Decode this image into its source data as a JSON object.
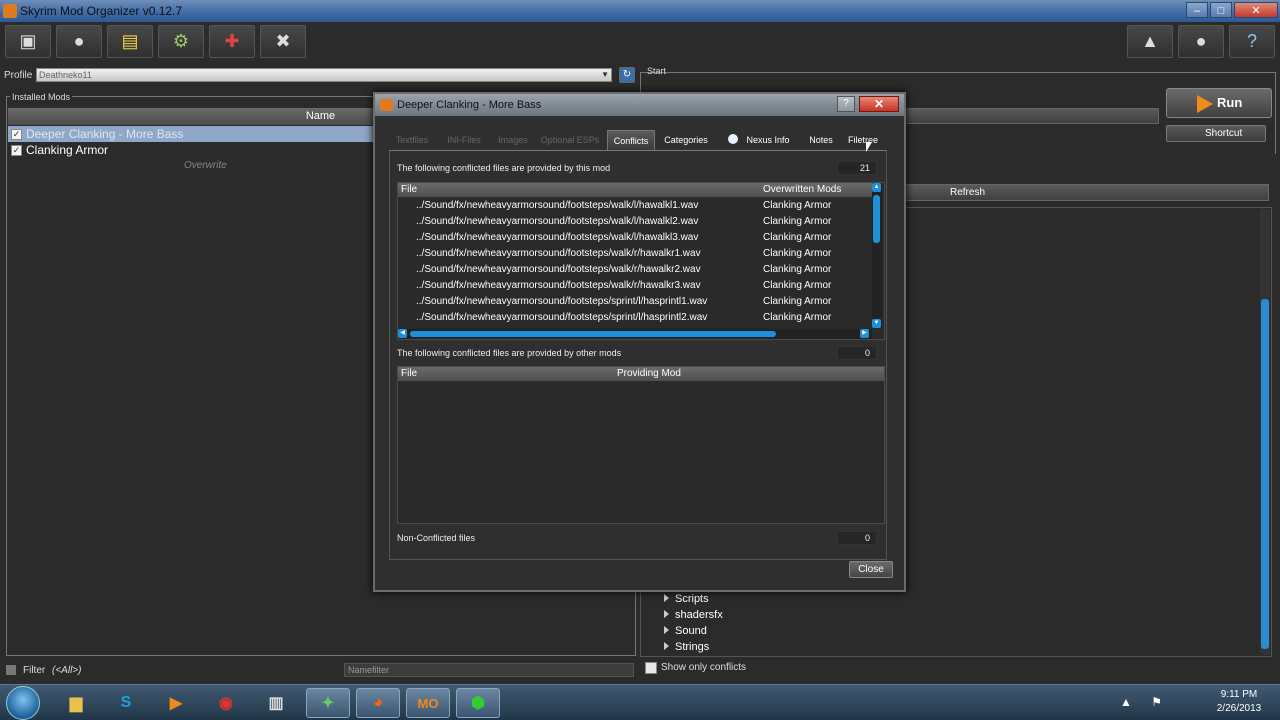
{
  "window": {
    "title": "Skyrim Mod Organizer v0.12.7",
    "controls": {
      "minimize": "–",
      "maximize": "□",
      "close": "✕"
    }
  },
  "toolbar": {
    "buttons": [
      {
        "name": "install-mod-button",
        "icon": "install-archive-icon",
        "glyph": "▣"
      },
      {
        "name": "nexus-button",
        "icon": "globe-icon",
        "glyph": "●"
      },
      {
        "name": "profiles-button",
        "icon": "profile-card-icon",
        "glyph": "▤"
      },
      {
        "name": "executables-button",
        "icon": "gears-icon",
        "glyph": "⚙"
      },
      {
        "name": "tools-dropdown-button",
        "icon": "puzzle-icon",
        "glyph": "✚"
      },
      {
        "name": "settings-button",
        "icon": "wrench-icon",
        "glyph": "✖"
      }
    ],
    "right_buttons": [
      {
        "name": "problems-button",
        "icon": "warning-icon",
        "glyph": "▲"
      },
      {
        "name": "update-button",
        "icon": "globe-update-icon",
        "glyph": "●"
      },
      {
        "name": "help-button",
        "icon": "help-icon",
        "glyph": "?"
      }
    ]
  },
  "profile": {
    "label": "Profile",
    "value": "Deathneko11"
  },
  "installed_mods": {
    "group_label": "Installed Mods",
    "column_name": "Name",
    "rows": [
      {
        "label": "Deeper Clanking - More Bass",
        "checked": true,
        "selected": true
      },
      {
        "label": "Clanking Armor",
        "checked": true,
        "selected": false
      }
    ],
    "overwrite": "Overwrite"
  },
  "filter": {
    "label": "Filter",
    "value": "(<All>)",
    "namefilter_placeholder": "Namefilter"
  },
  "right_panel": {
    "start_label": "Start",
    "run_label": "Run",
    "shortcut_label": "Shortcut",
    "refresh_label": "Refresh",
    "tree_items": [
      "Scripts",
      "shadersfx",
      "Sound",
      "Strings"
    ],
    "show_only_conflicts": "Show only conflicts"
  },
  "dialog": {
    "title": "Deeper Clanking - More Bass",
    "help_glyph": "?",
    "close_glyph": "✕",
    "tabs": [
      {
        "label": "Textfiles",
        "state": "disabled"
      },
      {
        "label": "INI-Files",
        "state": "disabled"
      },
      {
        "label": "Images",
        "state": "disabled"
      },
      {
        "label": "Optional ESPs",
        "state": "disabled"
      },
      {
        "label": "Conflicts",
        "state": "active"
      },
      {
        "label": "Categories",
        "state": "enabled"
      },
      {
        "label": "Nexus Info",
        "state": "enabled"
      },
      {
        "label": "Notes",
        "state": "enabled"
      },
      {
        "label": "Filetree",
        "state": "enabled"
      }
    ],
    "section1_label": "The following conflicted files are provided by this mod",
    "section1_count": "21",
    "table1": {
      "col_file": "File",
      "col_mods": "Overwritten Mods",
      "rows": [
        {
          "file": "../Sound/fx/newheavyarmorsound/footsteps/walk/l/hawalkl1.wav",
          "mod": "Clanking Armor"
        },
        {
          "file": "../Sound/fx/newheavyarmorsound/footsteps/walk/l/hawalkl2.wav",
          "mod": "Clanking Armor"
        },
        {
          "file": "../Sound/fx/newheavyarmorsound/footsteps/walk/l/hawalkl3.wav",
          "mod": "Clanking Armor"
        },
        {
          "file": "../Sound/fx/newheavyarmorsound/footsteps/walk/r/hawalkr1.wav",
          "mod": "Clanking Armor"
        },
        {
          "file": "../Sound/fx/newheavyarmorsound/footsteps/walk/r/hawalkr2.wav",
          "mod": "Clanking Armor"
        },
        {
          "file": "../Sound/fx/newheavyarmorsound/footsteps/walk/r/hawalkr3.wav",
          "mod": "Clanking Armor"
        },
        {
          "file": "../Sound/fx/newheavyarmorsound/footsteps/sprint/l/hasprintl1.wav",
          "mod": "Clanking Armor"
        },
        {
          "file": "../Sound/fx/newheavyarmorsound/footsteps/sprint/l/hasprintl2.wav",
          "mod": "Clanking Armor"
        }
      ]
    },
    "section2_label": "The following conflicted files are provided by other mods",
    "section2_count": "0",
    "table2": {
      "col_file": "File",
      "col_mod": "Providing Mod"
    },
    "section3_label": "Non-Conflicted files",
    "section3_count": "0",
    "close_button": "Close"
  },
  "taskbar": {
    "apps": [
      {
        "name": "explorer",
        "icon": "folder-icon",
        "glyph": "▆",
        "color": "#e8c24a"
      },
      {
        "name": "skype",
        "icon": "skype-icon",
        "glyph": "S",
        "color": "#1da0e0"
      },
      {
        "name": "media-player",
        "icon": "media-player-icon",
        "glyph": "▶",
        "color": "#f08a18"
      },
      {
        "name": "chrome",
        "icon": "chrome-icon",
        "glyph": "◉",
        "color": "#d33"
      },
      {
        "name": "app-99",
        "icon": "notepad-icon",
        "glyph": "▥",
        "color": "#ddd"
      },
      {
        "name": "skyrim",
        "icon": "skyrim-icon",
        "glyph": "✦",
        "color": "#6c6"
      },
      {
        "name": "firefox",
        "icon": "firefox-icon",
        "glyph": "◕",
        "color": "#f60"
      },
      {
        "name": "mod-organizer",
        "icon": "mod-organizer-icon",
        "glyph": "MO",
        "color": "#f08a18"
      },
      {
        "name": "app-green",
        "icon": "recorder-icon",
        "glyph": "⬢",
        "color": "#3c3"
      }
    ],
    "tray_glyphs": "▲ ⚑ ▭ ◀)",
    "time": "9:11 PM",
    "date": "2/26/2013"
  }
}
